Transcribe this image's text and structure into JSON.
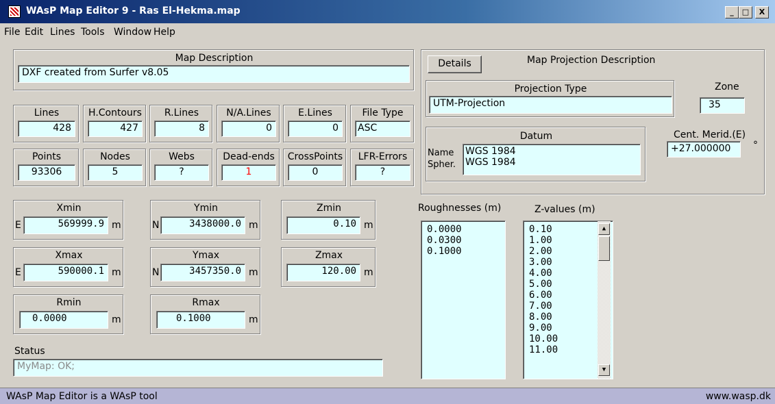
{
  "window": {
    "title": "WAsP Map Editor 9 - Ras El-Hekma.map",
    "minimize": "_",
    "maximize": "□",
    "close": "X"
  },
  "menu": [
    "File",
    "Edit",
    "Lines",
    "Tools",
    "Window",
    "Help"
  ],
  "map_description": {
    "label": "Map Description",
    "value": "DXF created from Surfer v8.05"
  },
  "stats_row1": [
    {
      "label": "Lines",
      "value": "428"
    },
    {
      "label": "H.Contours",
      "value": "427"
    },
    {
      "label": "R.Lines",
      "value": "8"
    },
    {
      "label": "N/A.Lines",
      "value": "0"
    },
    {
      "label": "E.Lines",
      "value": "0"
    },
    {
      "label": "File Type",
      "value": "ASC"
    }
  ],
  "stats_row2": [
    {
      "label": "Points",
      "value": "93306"
    },
    {
      "label": "Nodes",
      "value": "5"
    },
    {
      "label": "Webs",
      "value": "?"
    },
    {
      "label": "Dead-ends",
      "value": "1"
    },
    {
      "label": "CrossPoints",
      "value": "0"
    },
    {
      "label": "LFR-Errors",
      "value": "?"
    }
  ],
  "extents": {
    "xmin": {
      "label": "Xmin",
      "prefix": "E",
      "value": "569999.9",
      "unit": "m"
    },
    "ymin": {
      "label": "Ymin",
      "prefix": "N",
      "value": "3438000.0",
      "unit": "m"
    },
    "zmin": {
      "label": "Zmin",
      "value": "0.10",
      "unit": "m"
    },
    "xmax": {
      "label": "Xmax",
      "prefix": "E",
      "value": "590000.1",
      "unit": "m"
    },
    "ymax": {
      "label": "Ymax",
      "prefix": "N",
      "value": "3457350.0",
      "unit": "m"
    },
    "zmax": {
      "label": "Zmax",
      "value": "120.00",
      "unit": "m"
    },
    "rmin": {
      "label": "Rmin",
      "value": "0.0000",
      "unit": "m"
    },
    "rmax": {
      "label": "Rmax",
      "value": "0.1000",
      "unit": "m"
    }
  },
  "status": {
    "label": "Status",
    "value": "MyMap: OK;"
  },
  "projection": {
    "details_button": "Details",
    "title": "Map Projection Description",
    "type_label": "Projection Type",
    "type_value": "UTM-Projection",
    "zone_label": "Zone",
    "zone_value": "35",
    "datum_label": "Datum",
    "name_label": "Name",
    "name_value": "WGS 1984",
    "spher_label": "Spher.",
    "spher_value": "WGS 1984",
    "cm_label": "Cent. Merid.(E)",
    "cm_value": "+27.000000",
    "degree_symbol": "°"
  },
  "roughnesses": {
    "label": "Roughnesses (m)",
    "items": [
      "0.0000",
      "0.0300",
      "0.1000"
    ]
  },
  "zvalues": {
    "label": "Z-values (m)",
    "items": [
      "0.10",
      "1.00",
      "2.00",
      "3.00",
      "4.00",
      "5.00",
      "6.00",
      "7.00",
      "8.00",
      "9.00",
      "10.00",
      "11.00"
    ]
  },
  "statusbar": {
    "left": "WAsP Map Editor is a WAsP tool",
    "right": "www.wasp.dk"
  }
}
